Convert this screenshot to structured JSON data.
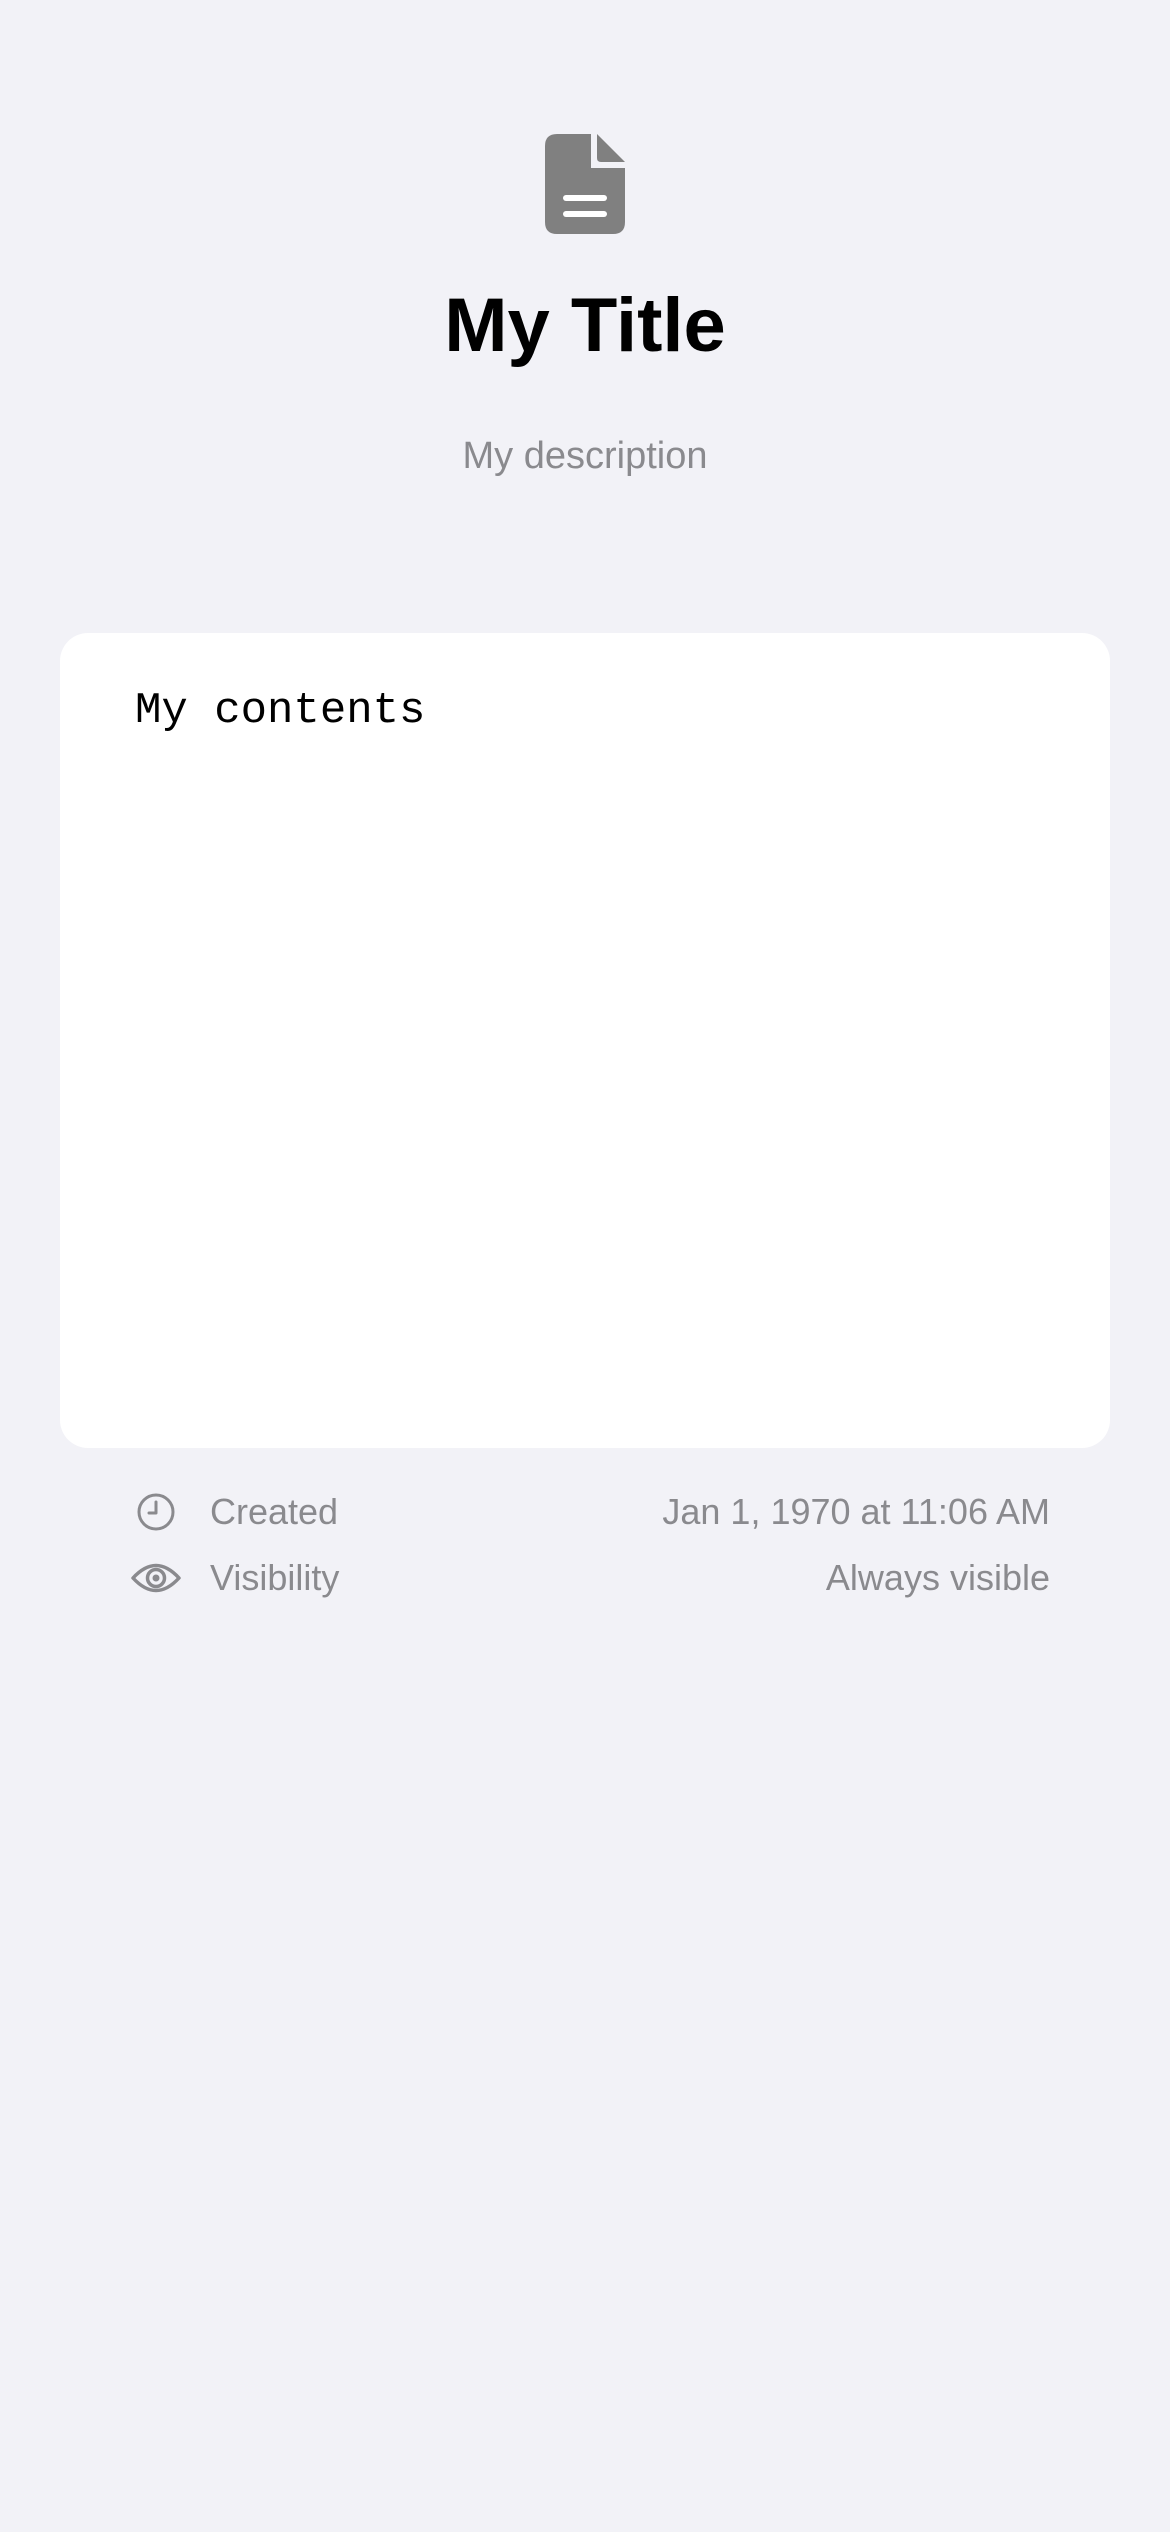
{
  "header": {
    "icon": "document-icon",
    "title": "My Title",
    "description": "My description"
  },
  "content": {
    "text": "My contents"
  },
  "metadata": [
    {
      "icon": "clock-icon",
      "label": "Created",
      "value": "Jan 1, 1970 at 11:06 AM"
    },
    {
      "icon": "eye-icon",
      "label": "Visibility",
      "value": "Always visible"
    }
  ],
  "colors": {
    "background": "#f2f2f7",
    "card": "#ffffff",
    "secondary_text": "#8a8a8e",
    "icon_gray": "#808080"
  }
}
